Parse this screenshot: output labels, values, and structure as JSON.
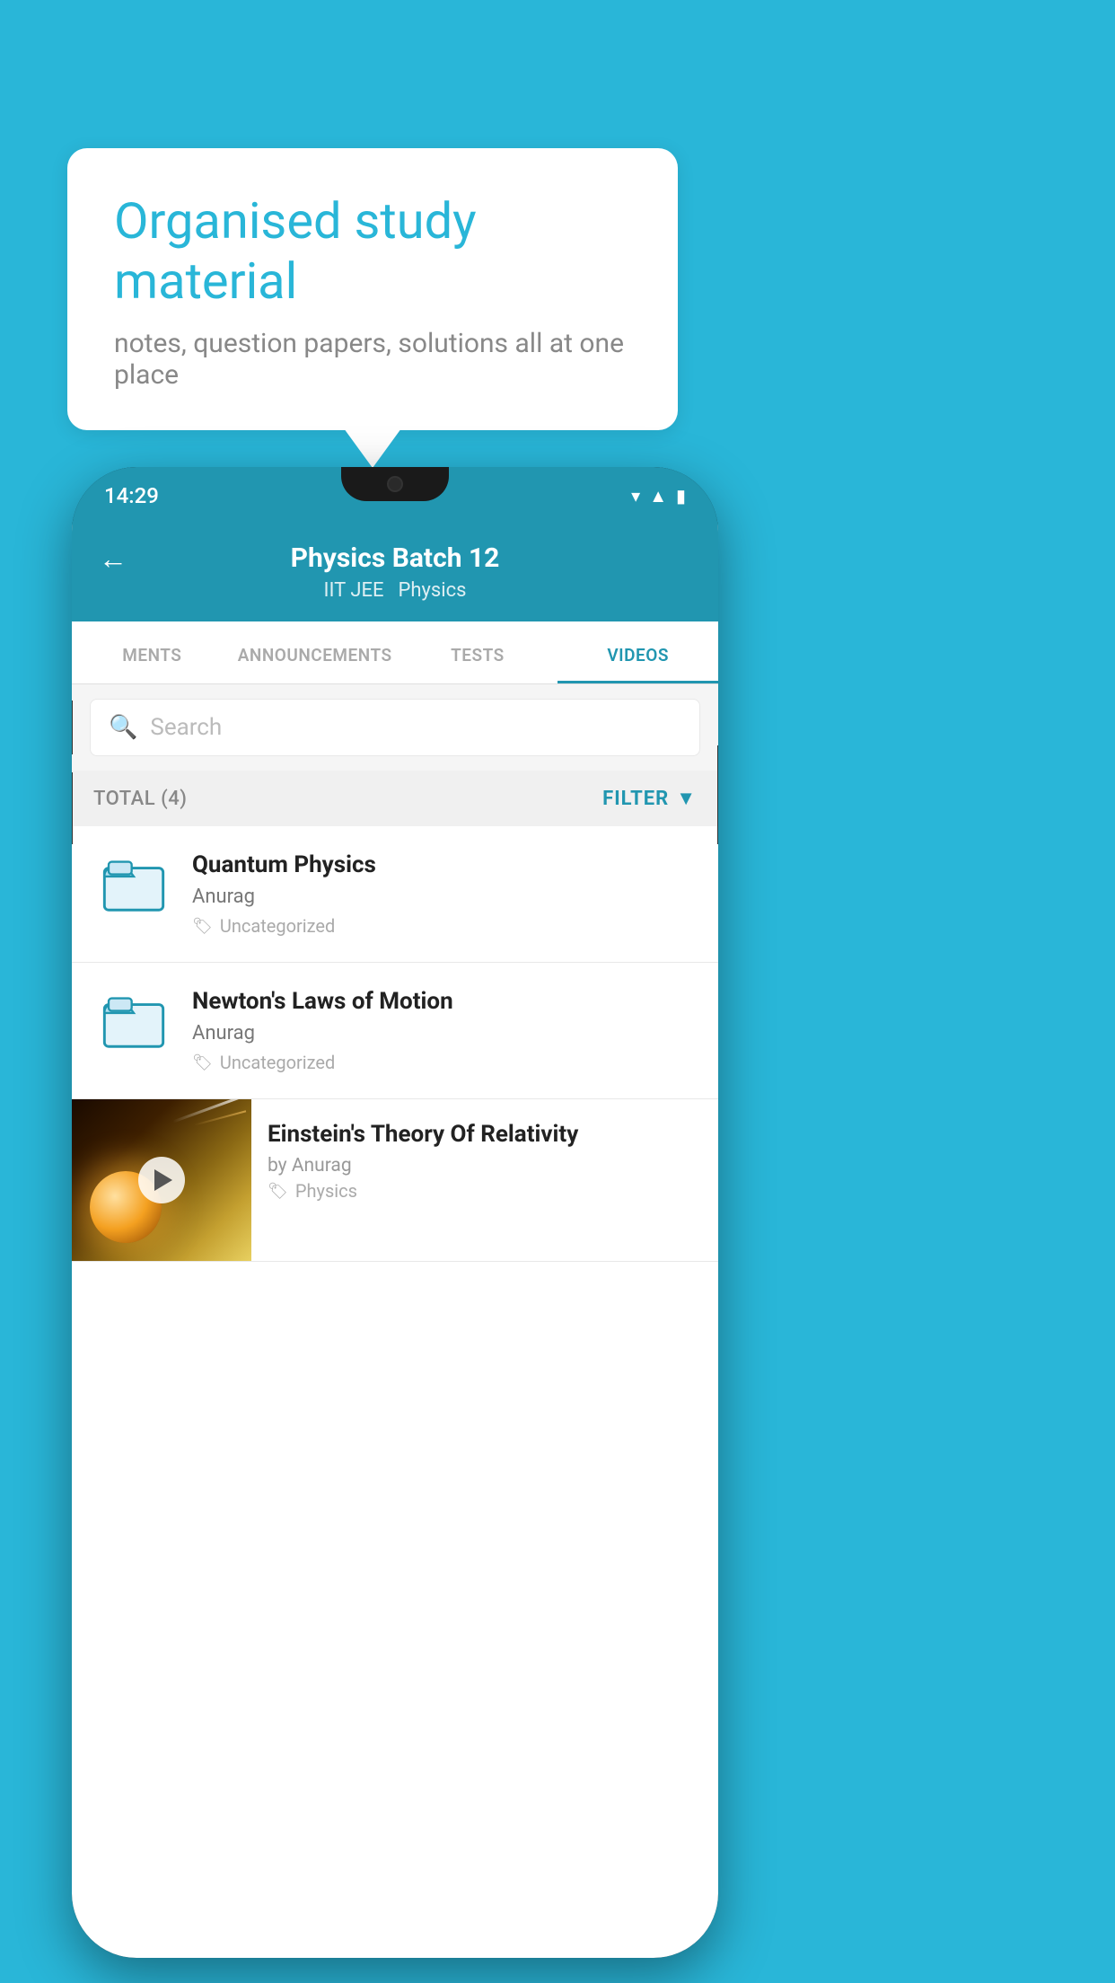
{
  "background": {
    "color": "#29b6d8"
  },
  "speech_bubble": {
    "title": "Organised study material",
    "subtitle": "notes, question papers, solutions all at one place"
  },
  "phone": {
    "status_bar": {
      "time": "14:29"
    },
    "header": {
      "title": "Physics Batch 12",
      "subtitle1": "IIT JEE",
      "subtitle2": "Physics",
      "back_label": "←"
    },
    "tabs": [
      {
        "label": "MENTS",
        "active": false
      },
      {
        "label": "ANNOUNCEMENTS",
        "active": false
      },
      {
        "label": "TESTS",
        "active": false
      },
      {
        "label": "VIDEOS",
        "active": true
      }
    ],
    "search": {
      "placeholder": "Search"
    },
    "filter": {
      "total_label": "TOTAL (4)",
      "filter_label": "FILTER"
    },
    "videos": [
      {
        "title": "Quantum Physics",
        "author": "Anurag",
        "tag": "Uncategorized",
        "type": "folder"
      },
      {
        "title": "Newton's Laws of Motion",
        "author": "Anurag",
        "tag": "Uncategorized",
        "type": "folder"
      },
      {
        "title": "Einstein's Theory Of Relativity",
        "author_prefix": "by",
        "author": "Anurag",
        "tag": "Physics",
        "type": "video"
      }
    ]
  }
}
